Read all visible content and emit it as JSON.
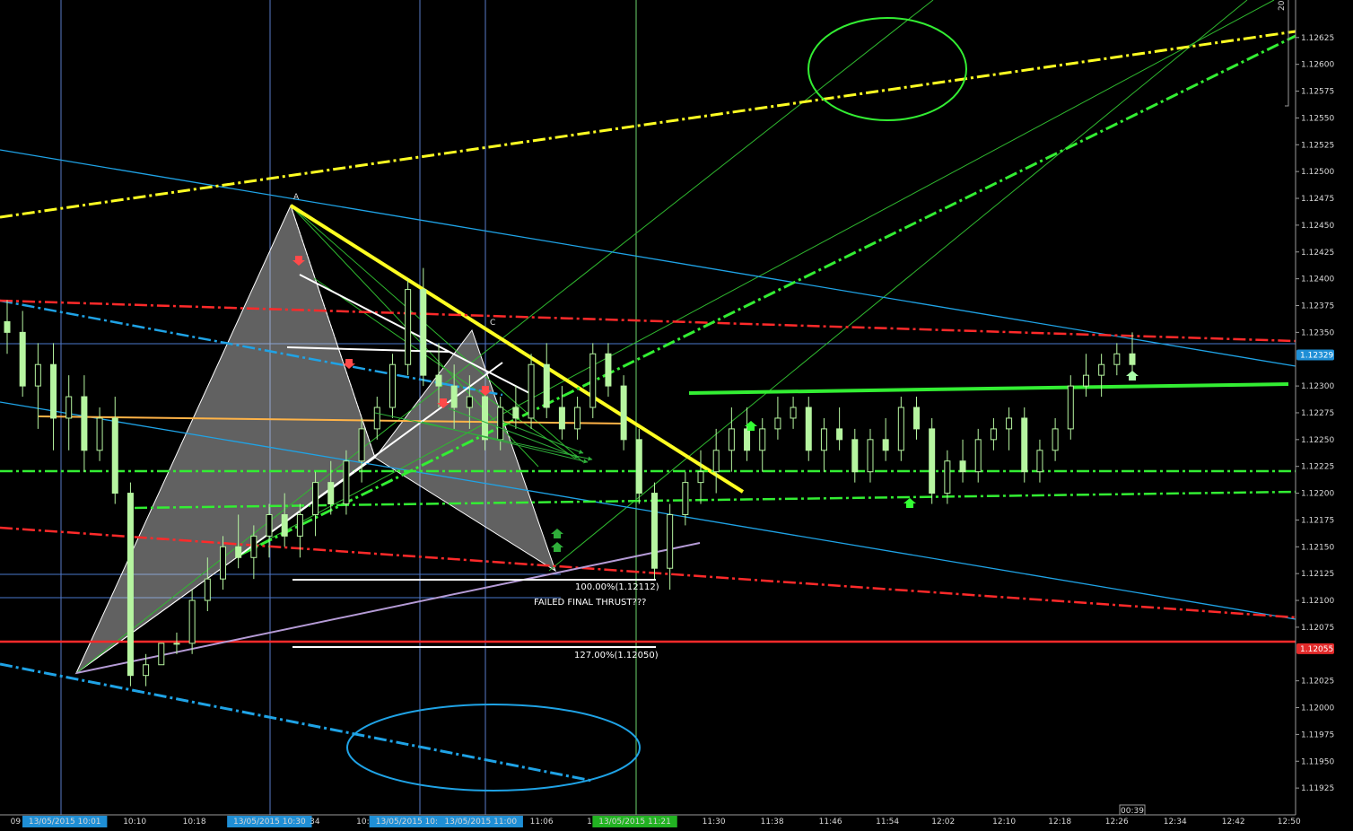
{
  "chart_data": {
    "type": "candlestick",
    "price_axis": {
      "range": [
        1.119,
        1.1266
      ],
      "ticks": [
        "1.12625",
        "1.12600",
        "1.12575",
        "1.12550",
        "1.12525",
        "1.12500",
        "1.12475",
        "1.12450",
        "1.12425",
        "1.12400",
        "1.12375",
        "1.12350",
        "1.12300",
        "1.12275",
        "1.12250",
        "1.12225",
        "1.12200",
        "1.12175",
        "1.12150",
        "1.12125",
        "1.12100",
        "1.12075",
        "1.12025",
        "1.12000",
        "1.11975",
        "1.11950",
        "1.11925"
      ],
      "current_price": "1.12329",
      "marked_price": "1.12055",
      "corner_label": "20"
    },
    "time_axis": {
      "labels": [
        {
          "text": "09",
          "pos": 0.012
        },
        {
          "text": "13/05/2015 10:01",
          "pos": 0.05,
          "highlight": "blue"
        },
        {
          "text": "10:10",
          "pos": 0.104
        },
        {
          "text": "10:18",
          "pos": 0.15
        },
        {
          "text": "13/05/2015 10:30",
          "pos": 0.208,
          "highlight": "blue"
        },
        {
          "text": "34",
          "pos": 0.243
        },
        {
          "text": "10:42",
          "pos": 0.284
        },
        {
          "text": "13/05/2015 10:",
          "pos": 0.314,
          "highlight": "blue"
        },
        {
          "text": "13/05/2015 11:00",
          "pos": 0.371,
          "highlight": "blue"
        },
        {
          "text": "11:06",
          "pos": 0.418
        },
        {
          "text": "11",
          "pos": 0.457
        },
        {
          "text": "13/05/2015 11:21",
          "pos": 0.49,
          "highlight": "green"
        },
        {
          "text": "11:30",
          "pos": 0.551
        },
        {
          "text": "11:38",
          "pos": 0.596
        },
        {
          "text": "11:46",
          "pos": 0.641
        },
        {
          "text": "11:54",
          "pos": 0.685
        },
        {
          "text": "12:02",
          "pos": 0.728
        },
        {
          "text": "12:10",
          "pos": 0.775
        },
        {
          "text": "12:18",
          "pos": 0.818
        },
        {
          "text": "12:26",
          "pos": 0.862
        },
        {
          "text": "12:34",
          "pos": 0.907
        },
        {
          "text": "12:42",
          "pos": 0.952
        },
        {
          "text": "12:50",
          "pos": 0.995
        }
      ],
      "countdown": "00:39"
    },
    "annotations": {
      "fib_100": "100.00%(1.12112)",
      "fib_127": "127.00%(1.12050)",
      "comment": "FAILED FINAL THRUST???",
      "point_a": "A",
      "point_c": "C"
    },
    "colors": {
      "background": "#000000",
      "candle": "#b6f5a0",
      "grid_vertical": "#5a7cc8",
      "yellow": "#ffff22",
      "green": "#33ee33",
      "red": "#ff2a2a",
      "blue": "#1fa3e6",
      "orange": "#ffb347",
      "purple": "#b59bd6",
      "white": "#ffffff",
      "harmonic_fill": "#d8d8d8"
    },
    "series": [
      {
        "name": "candles",
        "ohlc": [
          [
            1.1236,
            1.1238,
            1.1233,
            1.1235
          ],
          [
            1.1235,
            1.1237,
            1.1229,
            1.123
          ],
          [
            1.123,
            1.1234,
            1.1226,
            1.1232
          ],
          [
            1.1232,
            1.1234,
            1.1224,
            1.1227
          ],
          [
            1.1227,
            1.1231,
            1.1224,
            1.1229
          ],
          [
            1.1229,
            1.1231,
            1.1222,
            1.1224
          ],
          [
            1.1224,
            1.1228,
            1.1223,
            1.1227
          ],
          [
            1.1227,
            1.1229,
            1.1219,
            1.122
          ],
          [
            1.122,
            1.1221,
            1.1202,
            1.1203
          ],
          [
            1.1203,
            1.1205,
            1.1202,
            1.1204
          ],
          [
            1.1204,
            1.1206,
            1.1204,
            1.1206
          ],
          [
            1.1206,
            1.1207,
            1.1205,
            1.1206
          ],
          [
            1.1206,
            1.1211,
            1.1205,
            1.121
          ],
          [
            1.121,
            1.1214,
            1.1209,
            1.1212
          ],
          [
            1.1212,
            1.1216,
            1.1211,
            1.1215
          ],
          [
            1.1215,
            1.1218,
            1.1213,
            1.1214
          ],
          [
            1.1214,
            1.1217,
            1.1212,
            1.1216
          ],
          [
            1.1216,
            1.1219,
            1.1214,
            1.1218
          ],
          [
            1.1218,
            1.122,
            1.1215,
            1.1216
          ],
          [
            1.1216,
            1.1219,
            1.1214,
            1.1218
          ],
          [
            1.1218,
            1.1222,
            1.1216,
            1.1221
          ],
          [
            1.1221,
            1.1223,
            1.1218,
            1.1219
          ],
          [
            1.1219,
            1.1224,
            1.1218,
            1.1223
          ],
          [
            1.1223,
            1.1227,
            1.1221,
            1.1226
          ],
          [
            1.1226,
            1.1229,
            1.1225,
            1.1228
          ],
          [
            1.1228,
            1.1233,
            1.1227,
            1.1232
          ],
          [
            1.1232,
            1.124,
            1.1231,
            1.1239
          ],
          [
            1.1239,
            1.1241,
            1.123,
            1.1231
          ],
          [
            1.1231,
            1.1234,
            1.1228,
            1.123
          ],
          [
            1.123,
            1.1232,
            1.1226,
            1.1228
          ],
          [
            1.1228,
            1.1231,
            1.1226,
            1.1229
          ],
          [
            1.1229,
            1.123,
            1.1224,
            1.1225
          ],
          [
            1.1225,
            1.1229,
            1.1224,
            1.1228
          ],
          [
            1.1228,
            1.123,
            1.1226,
            1.1227
          ],
          [
            1.1227,
            1.1233,
            1.1226,
            1.1232
          ],
          [
            1.1232,
            1.1234,
            1.1227,
            1.1228
          ],
          [
            1.1228,
            1.123,
            1.1225,
            1.1226
          ],
          [
            1.1226,
            1.1229,
            1.1225,
            1.1228
          ],
          [
            1.1228,
            1.1234,
            1.1227,
            1.1233
          ],
          [
            1.1233,
            1.1234,
            1.1229,
            1.123
          ],
          [
            1.123,
            1.1231,
            1.1224,
            1.1225
          ],
          [
            1.1225,
            1.1226,
            1.1219,
            1.122
          ],
          [
            1.122,
            1.1221,
            1.1212,
            1.1213
          ],
          [
            1.1213,
            1.1219,
            1.1211,
            1.1218
          ],
          [
            1.1218,
            1.1222,
            1.1217,
            1.1221
          ],
          [
            1.1221,
            1.1224,
            1.1219,
            1.1222
          ],
          [
            1.1222,
            1.1226,
            1.122,
            1.1224
          ],
          [
            1.1224,
            1.1228,
            1.1222,
            1.1226
          ],
          [
            1.1226,
            1.1228,
            1.1223,
            1.1224
          ],
          [
            1.1224,
            1.1227,
            1.1222,
            1.1226
          ],
          [
            1.1226,
            1.1229,
            1.1225,
            1.1227
          ],
          [
            1.1227,
            1.1229,
            1.1226,
            1.1228
          ],
          [
            1.1228,
            1.1229,
            1.1223,
            1.1224
          ],
          [
            1.1224,
            1.1227,
            1.1222,
            1.1226
          ],
          [
            1.1226,
            1.1228,
            1.1224,
            1.1225
          ],
          [
            1.1225,
            1.1226,
            1.1221,
            1.1222
          ],
          [
            1.1222,
            1.1226,
            1.1221,
            1.1225
          ],
          [
            1.1225,
            1.1227,
            1.1223,
            1.1224
          ],
          [
            1.1224,
            1.1229,
            1.1223,
            1.1228
          ],
          [
            1.1228,
            1.1229,
            1.1225,
            1.1226
          ],
          [
            1.1226,
            1.1227,
            1.1219,
            1.122
          ],
          [
            1.122,
            1.1224,
            1.1219,
            1.1223
          ],
          [
            1.1223,
            1.1225,
            1.1221,
            1.1222
          ],
          [
            1.1222,
            1.1226,
            1.1221,
            1.1225
          ],
          [
            1.1225,
            1.1227,
            1.1224,
            1.1226
          ],
          [
            1.1226,
            1.1228,
            1.1224,
            1.1227
          ],
          [
            1.1227,
            1.1228,
            1.1221,
            1.1222
          ],
          [
            1.1222,
            1.1225,
            1.1221,
            1.1224
          ],
          [
            1.1224,
            1.1227,
            1.1223,
            1.1226
          ],
          [
            1.1226,
            1.1231,
            1.1225,
            1.123
          ],
          [
            1.123,
            1.1233,
            1.1229,
            1.1231
          ],
          [
            1.1231,
            1.1233,
            1.1229,
            1.1232
          ],
          [
            1.1232,
            1.1234,
            1.1231,
            1.1233
          ],
          [
            1.1233,
            1.1235,
            1.1231,
            1.1232
          ]
        ]
      }
    ]
  }
}
